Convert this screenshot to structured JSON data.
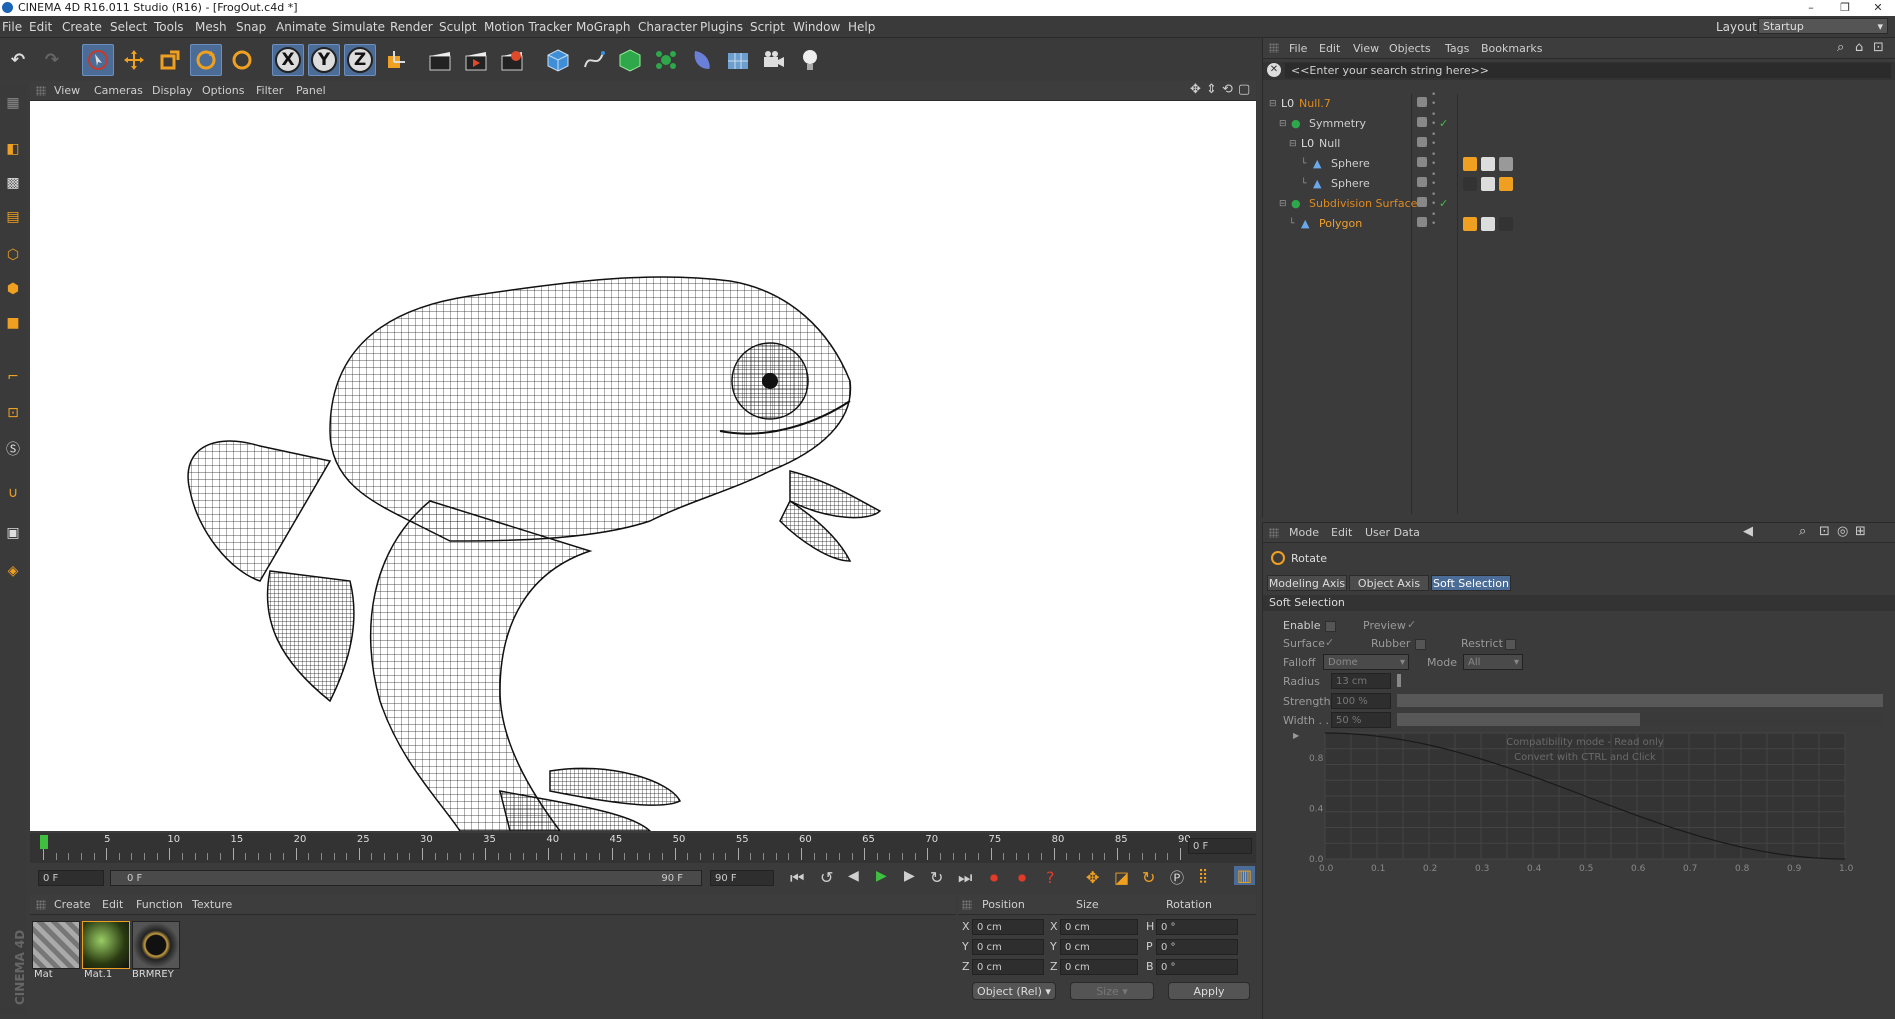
{
  "window": {
    "title": "CINEMA 4D R16.011 Studio (R16) - [FrogOut.c4d *]"
  },
  "menu": [
    "File",
    "Edit",
    "Create",
    "Select",
    "Tools",
    "Mesh",
    "Snap",
    "Animate",
    "Simulate",
    "Render",
    "Sculpt",
    "Motion Tracker",
    "MoGraph",
    "Character",
    "Plugins",
    "Script",
    "Window",
    "Help"
  ],
  "layout": {
    "label": "Layout:",
    "value": "Startup"
  },
  "toolbar": {
    "axis_x": "X",
    "axis_y": "Y",
    "axis_z": "Z"
  },
  "viewport": {
    "menu": [
      "View",
      "Cameras",
      "Display",
      "Options",
      "Filter",
      "Panel"
    ]
  },
  "timeline": {
    "ticks": [
      "0",
      "5",
      "10",
      "15",
      "20",
      "25",
      "30",
      "35",
      "40",
      "45",
      "50",
      "55",
      "60",
      "65",
      "70",
      "75",
      "80",
      "85",
      "90"
    ],
    "current_frame": "0 F",
    "start": "0 F",
    "range_start": "0 F",
    "range_end": "90 F",
    "end": "90 F"
  },
  "material_manager": {
    "menu": [
      "Create",
      "Edit",
      "Function",
      "Texture"
    ],
    "materials": [
      {
        "name": "Mat"
      },
      {
        "name": "Mat.1"
      },
      {
        "name": "BRMREY"
      }
    ],
    "brand_text": "CINEMA 4D"
  },
  "coordinates": {
    "headers": {
      "position": "Position",
      "size": "Size",
      "rotation": "Rotation"
    },
    "rows": [
      {
        "axis": "X",
        "pos": "0 cm",
        "saxis": "X",
        "size": "0 cm",
        "raxis": "H",
        "rot": "0 °"
      },
      {
        "axis": "Y",
        "pos": "0 cm",
        "saxis": "Y",
        "size": "0 cm",
        "raxis": "P",
        "rot": "0 °"
      },
      {
        "axis": "Z",
        "pos": "0 cm",
        "saxis": "Z",
        "size": "0 cm",
        "raxis": "B",
        "rot": "0 °"
      }
    ],
    "mode": "Object (Rel)",
    "size_mode": "Size",
    "apply": "Apply"
  },
  "object_manager": {
    "menu": [
      "File",
      "Edit",
      "View",
      "Objects",
      "Tags",
      "Bookmarks"
    ],
    "search_placeholder": "<<Enter your search string here>>",
    "objects": [
      {
        "name": "Null.7",
        "color": "#e08a1e"
      },
      {
        "name": "Symmetry",
        "color": "#cfcfcf"
      },
      {
        "name": "Null",
        "color": "#cfcfcf"
      },
      {
        "name": "Sphere",
        "color": "#cfcfcf"
      },
      {
        "name": "Sphere",
        "color": "#cfcfcf"
      },
      {
        "name": "Subdivision Surface",
        "color": "#e08a1e"
      },
      {
        "name": "Polygon",
        "color": "#f0a030"
      }
    ]
  },
  "attributes": {
    "menu": [
      "Mode",
      "Edit",
      "User Data"
    ],
    "tool_name": "Rotate",
    "tabs": [
      "Modeling Axis",
      "Object Axis",
      "Soft Selection"
    ],
    "section": "Soft Selection",
    "enable": "Enable",
    "preview": "Preview",
    "surface": "Surface",
    "rubber": "Rubber",
    "restrict": "Restrict",
    "falloff": "Falloff",
    "falloff_value": "Dome",
    "mode": "Mode",
    "mode_value": "All",
    "radius": "Radius",
    "radius_value": "13 cm",
    "strength": "Strength",
    "strength_value": "100 %",
    "width": "Width . .",
    "width_value": "50 %",
    "strength_level": 1.0,
    "width_level": 0.5,
    "graph_note_1": "Compatibility mode - Read only",
    "graph_note_2": "Convert with CTRL and Click",
    "graph_y_ticks": [
      "0.8",
      "0.4",
      "0.0"
    ],
    "graph_x_ticks": [
      "0.0",
      "0.1",
      "0.2",
      "0.3",
      "0.4",
      "0.5",
      "0.6",
      "0.7",
      "0.8",
      "0.9",
      "1.0"
    ]
  }
}
